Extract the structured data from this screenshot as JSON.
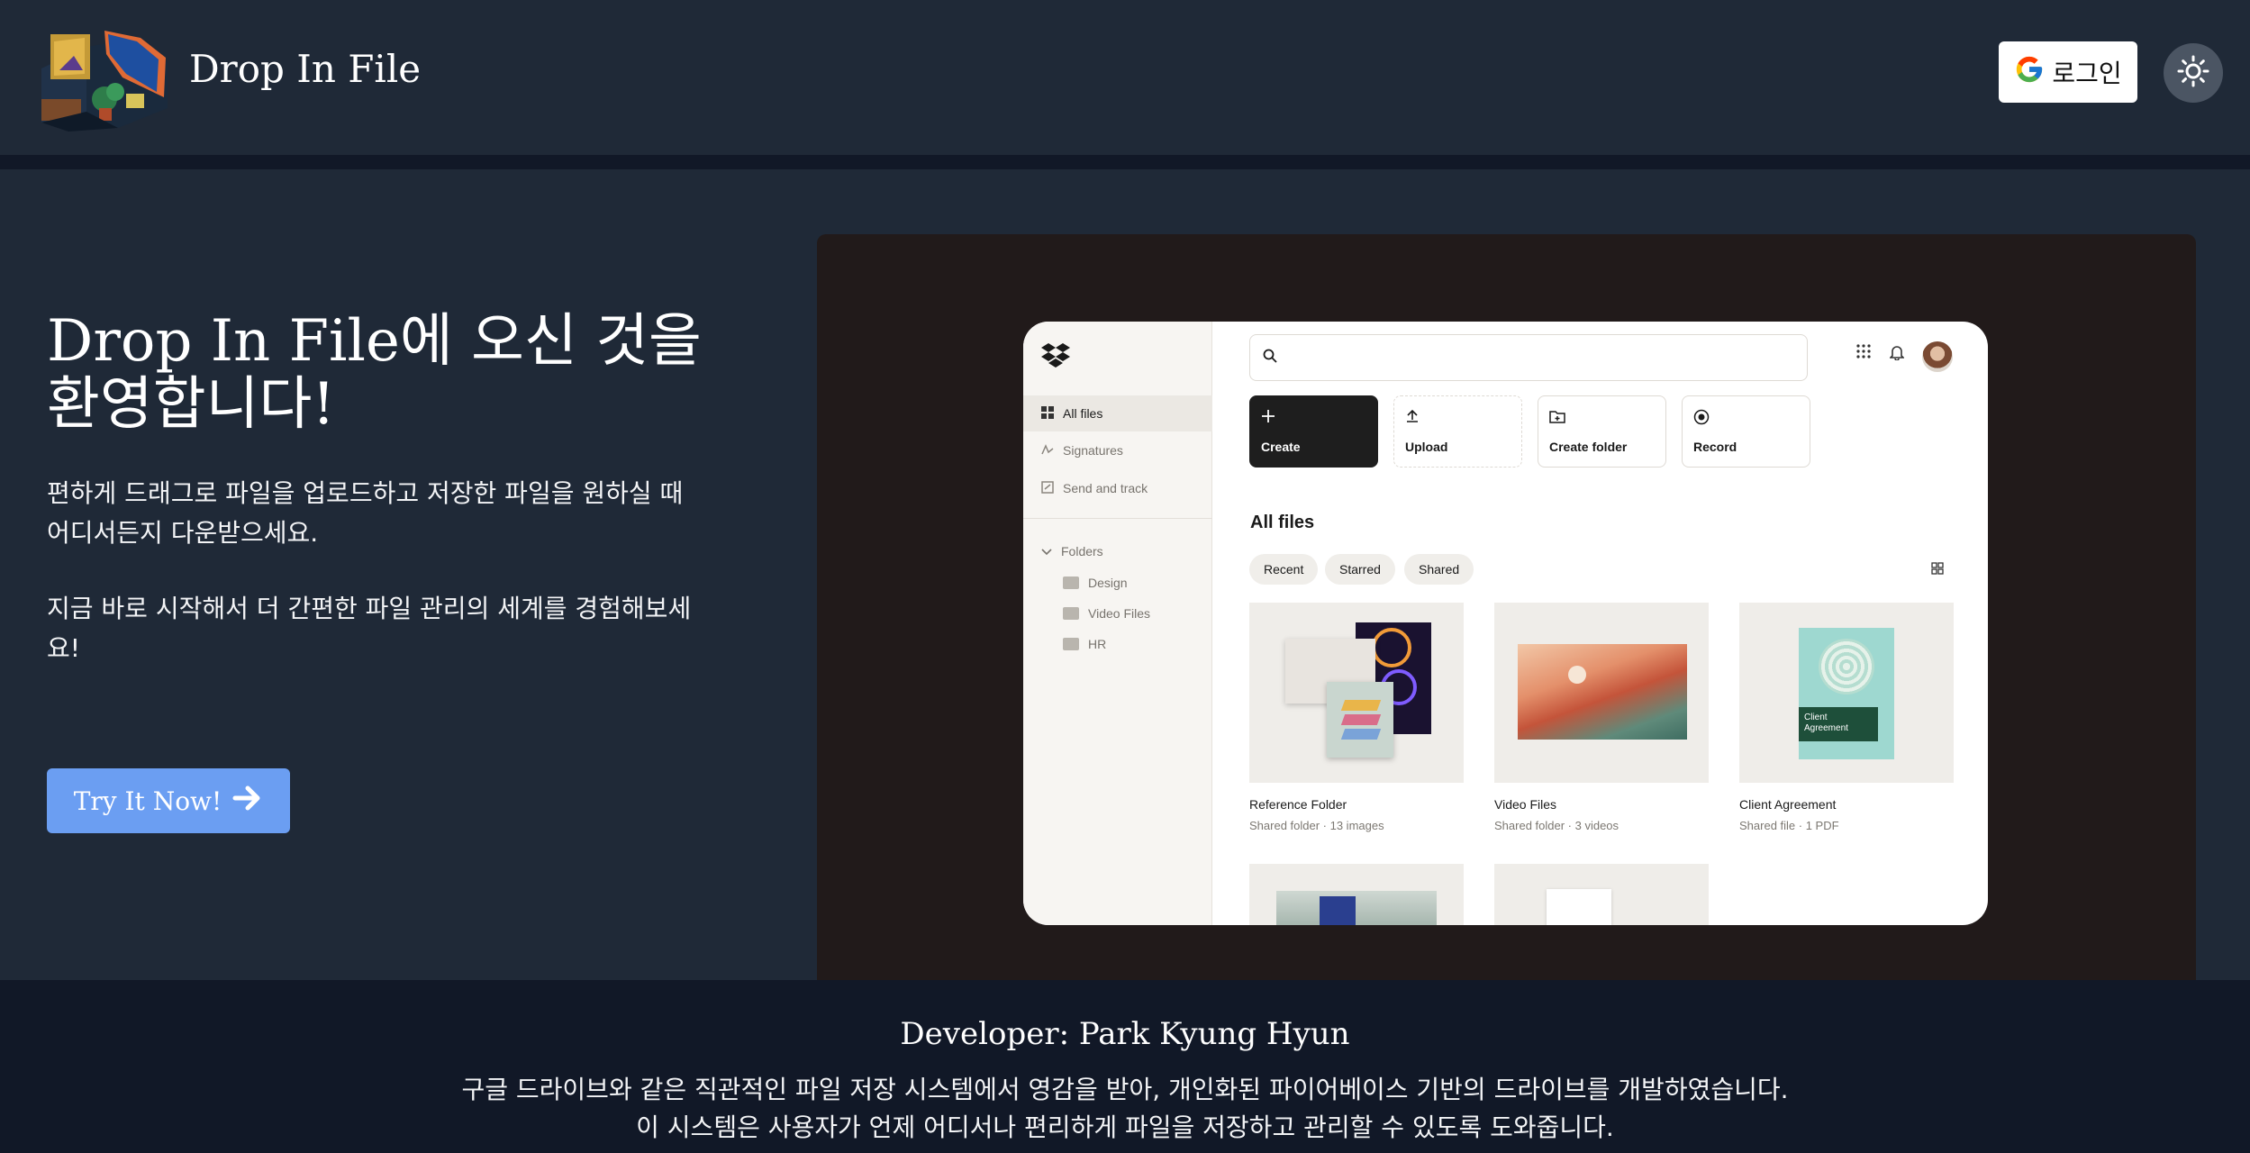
{
  "header": {
    "app_title": "Drop In File",
    "login_label": "로그인",
    "logo_icon": "isometric-room-logo",
    "google_icon": "google-g-icon",
    "theme_icon": "sun-icon"
  },
  "hero": {
    "title": "Drop In File에 오신 것을 환영합니다!",
    "desc1": "편하게 드래그로 파일을 업로드하고 저장한 파일을 원하실 때 어디서든지 다운받으세요.",
    "desc2": "지금 바로 시작해서 더 간편한 파일 관리의 세계를 경험해보세요!",
    "cta_label": "Try It Now!"
  },
  "preview": {
    "sidebar": {
      "items": [
        {
          "label": "All files"
        },
        {
          "label": "Signatures"
        },
        {
          "label": "Send and track"
        }
      ],
      "folders_label": "Folders",
      "folders": [
        {
          "label": "Design"
        },
        {
          "label": "Video Files"
        },
        {
          "label": "HR"
        }
      ]
    },
    "actions": [
      {
        "label": "Create",
        "icon": "plus-icon"
      },
      {
        "label": "Upload",
        "icon": "upload-icon"
      },
      {
        "label": "Create folder",
        "icon": "folder-plus-icon"
      },
      {
        "label": "Record",
        "icon": "record-icon"
      }
    ],
    "section_title": "All files",
    "filters": [
      "Recent",
      "Starred",
      "Shared"
    ],
    "cards": [
      {
        "name": "Reference Folder",
        "meta": "Shared folder · 13 images"
      },
      {
        "name": "Video Files",
        "meta": "Shared folder · 3 videos"
      },
      {
        "name": "Client Agreement",
        "meta": "Shared file · 1 PDF",
        "thumb_text": "Client Agreement"
      }
    ]
  },
  "footer": {
    "developer": "Developer: Park Kyung Hyun",
    "line1": "구글 드라이브와 같은 직관적인 파일 저장 시스템에서 영감을 받아, 개인화된 파이어베이스 기반의 드라이브를 개발하였습니다.",
    "line2": "이 시스템은 사용자가 언제 어디서나 편리하게 파일을 저장하고 관리할 수 있도록 도와줍니다."
  },
  "colors": {
    "page_bg": "#1f2937",
    "footer_bg": "#111827",
    "cta_bg": "#6b9ef2",
    "preview_bg": "#211a1a"
  }
}
